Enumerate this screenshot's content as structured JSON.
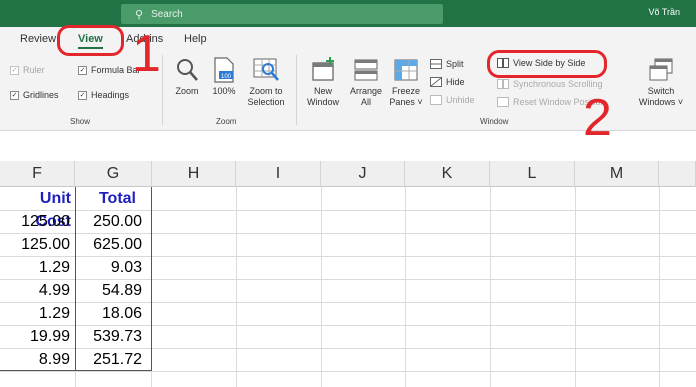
{
  "titlebar": {
    "search_placeholder": "Search",
    "user_name": "Võ Trần"
  },
  "tabs": [
    {
      "label": "Review"
    },
    {
      "label": "View"
    },
    {
      "label": "Add-ins"
    },
    {
      "label": "Help"
    }
  ],
  "show_group": {
    "title": "Show",
    "ruler": "Ruler",
    "formula_bar": "Formula Bar",
    "gridlines": "Gridlines",
    "headings": "Headings"
  },
  "zoom_group": {
    "title": "Zoom",
    "zoom": "Zoom",
    "zoom100": "100%",
    "zoom_to": "Zoom to",
    "selection": "Selection"
  },
  "window_group": {
    "title": "Window",
    "new_1": "New",
    "new_2": "Window",
    "arrange_1": "Arrange",
    "arrange_2": "All",
    "freeze_1": "Freeze",
    "freeze_2": "Panes ˅",
    "split": "Split",
    "hide": "Hide",
    "unhide": "Unhide",
    "view_side_by_side": "View Side by Side",
    "sync_scrolling": "Synchronous Scrolling",
    "reset_position": "Reset Window Position",
    "switch_1": "Switch",
    "switch_2": "Windows ˅"
  },
  "annotations": {
    "n1": "1",
    "n2": "2",
    "color": "#e3262b"
  },
  "columns": [
    "F",
    "G",
    "H",
    "I",
    "J",
    "K",
    "L",
    "M"
  ],
  "table": {
    "headers": [
      "Unit Cost",
      "Total"
    ],
    "rows": [
      [
        "125.00",
        "250.00"
      ],
      [
        "125.00",
        "625.00"
      ],
      [
        "1.29",
        "9.03"
      ],
      [
        "4.99",
        "54.89"
      ],
      [
        "1.29",
        "18.06"
      ],
      [
        "19.99",
        "539.73"
      ],
      [
        "8.99",
        "251.72"
      ]
    ]
  },
  "colors": {
    "brand": "#217346",
    "header_text": "#1f1fbf"
  }
}
